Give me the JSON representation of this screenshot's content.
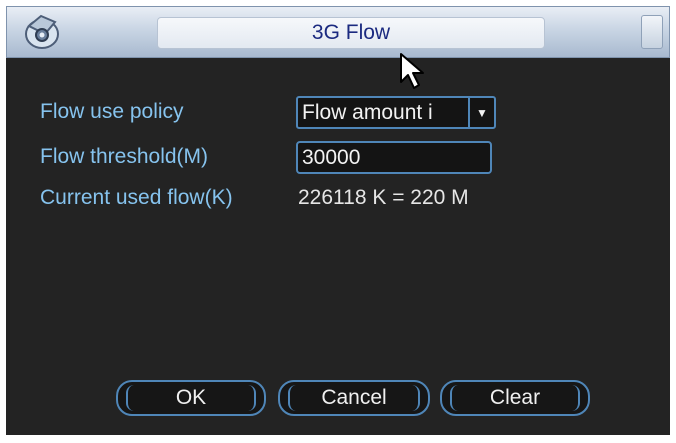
{
  "window": {
    "title": "3G Flow",
    "icon": "camera-app-icon",
    "close_icon": "close-icon"
  },
  "form": {
    "policy_label": "Flow use policy",
    "policy_value": "Flow amount i",
    "threshold_label": "Flow threshold(M)",
    "threshold_value": "30000",
    "current_label": "Current used flow(K)",
    "current_value": "226118 K = 220 M"
  },
  "buttons": {
    "ok": "OK",
    "cancel": "Cancel",
    "clear": "Clear"
  },
  "colors": {
    "label": "#86c3ee",
    "accent_border": "#4f86b8",
    "panel_bg": "#232323",
    "title_text": "#1b2a80"
  }
}
